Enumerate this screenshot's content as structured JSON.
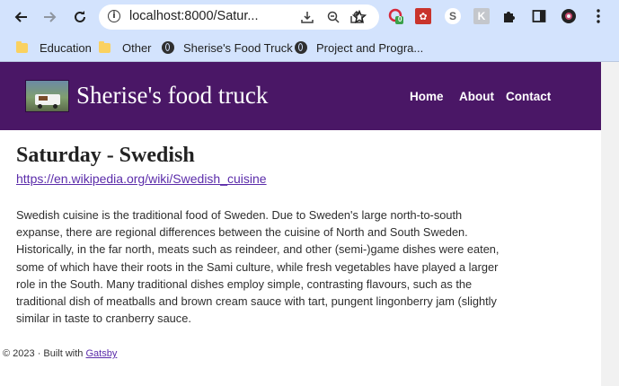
{
  "browser": {
    "url": "localhost:8000/Satur...",
    "bookmarks": [
      {
        "label": "Education",
        "icon": "folder-icon"
      },
      {
        "label": "Other",
        "icon": "folder-icon"
      },
      {
        "label": "Sherise's Food Truck",
        "icon": "globe-icon"
      },
      {
        "label": "Project and Progra...",
        "icon": "globe-icon"
      }
    ],
    "extension_badge": "0"
  },
  "site": {
    "title": "Sherise's food truck",
    "nav": [
      "Home",
      "About",
      "Contact"
    ],
    "header_color": "#4a1766"
  },
  "article": {
    "heading": "Saturday - Swedish",
    "link": "https://en.wikipedia.org/wiki/Swedish_cuisine",
    "paragraph_lines": [
      "Swedish cuisine is the traditional food of Sweden. Due to Sweden's large north-to-south",
      "expanse, there are regional differences between the cuisine of North and South Sweden.",
      "Historically, in the far north, meats such as reindeer, and other (semi-)game dishes were eaten,",
      "some of which have their roots in the Sami culture, while fresh vegetables have played a larger",
      "role in the South. Many traditional dishes employ simple, contrasting flavours, such as the",
      "traditional dish of meatballs and brown cream sauce with tart, pungent lingonberry jam (slightly",
      "similar in taste to cranberry sauce."
    ]
  },
  "footer": {
    "prefix": "© 2023 · Built with",
    "link": "Gatsby"
  }
}
